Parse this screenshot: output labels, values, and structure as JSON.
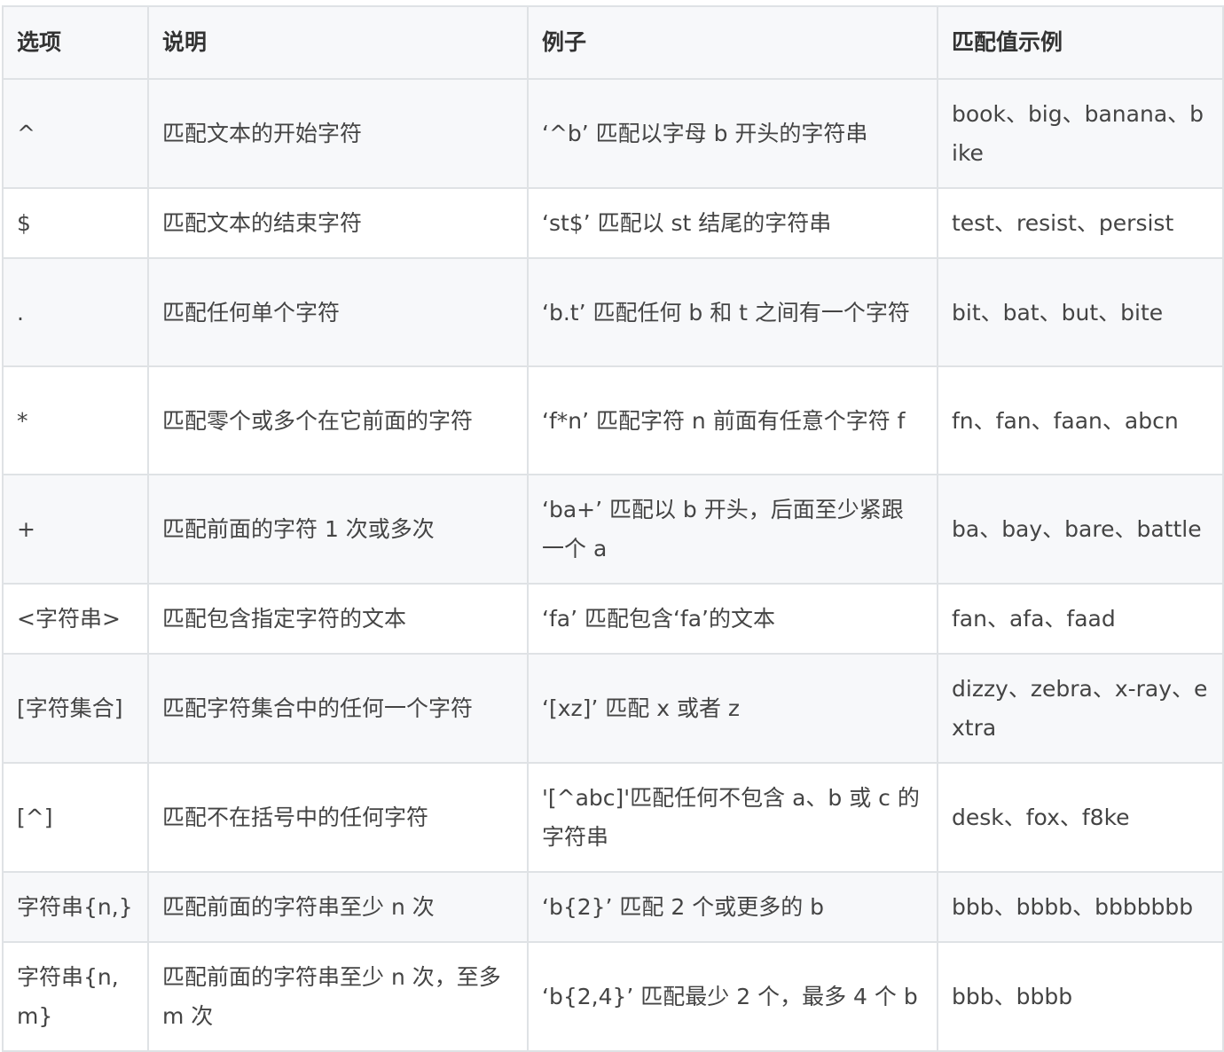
{
  "table": {
    "headers": [
      "选项",
      "说明",
      "例子",
      "匹配值示例"
    ],
    "rows": [
      [
        "^",
        "匹配文本的开始字符",
        "‘^b’ 匹配以字母 b 开头的字符串",
        "book、big、banana、bike"
      ],
      [
        "$",
        "匹配文本的结束字符",
        "‘st$’ 匹配以 st 结尾的字符串",
        "test、resist、persist"
      ],
      [
        ".",
        "匹配任何单个字符",
        "‘b.t’ 匹配任何 b 和 t 之间有一个字符",
        "bit、bat、but、bite"
      ],
      [
        "*",
        "匹配零个或多个在它前面的字符",
        "‘f*n’ 匹配字符 n 前面有任意个字符 f",
        "fn、fan、faan、abcn"
      ],
      [
        "+",
        "匹配前面的字符 1 次或多次",
        "‘ba+’ 匹配以 b 开头，后面至少紧跟一个 a",
        "ba、bay、bare、battle"
      ],
      [
        "<字符串>",
        "匹配包含指定字符的文本",
        "‘fa’ 匹配包含‘fa’的文本",
        "fan、afa、faad"
      ],
      [
        "[字符集合]",
        "匹配字符集合中的任何一个字符",
        "‘[xz]’ 匹配 x 或者 z",
        "dizzy、zebra、x-ray、extra"
      ],
      [
        "[^]",
        "匹配不在括号中的任何字符",
        "'[^abc]'匹配任何不包含 a、b 或 c 的字符串",
        "desk、fox、f8ke"
      ],
      [
        "字符串{n,}",
        "匹配前面的字符串至少 n 次",
        "‘b{2}’ 匹配 2 个或更多的 b",
        "bbb、bbbb、bbbbbbb"
      ],
      [
        "字符串{n,m}",
        "匹配前面的字符串至少 n 次，至多 m 次",
        "‘b{2,4}’ 匹配最少 2 个，最多 4 个 b",
        "bbb、bbbb"
      ]
    ]
  }
}
